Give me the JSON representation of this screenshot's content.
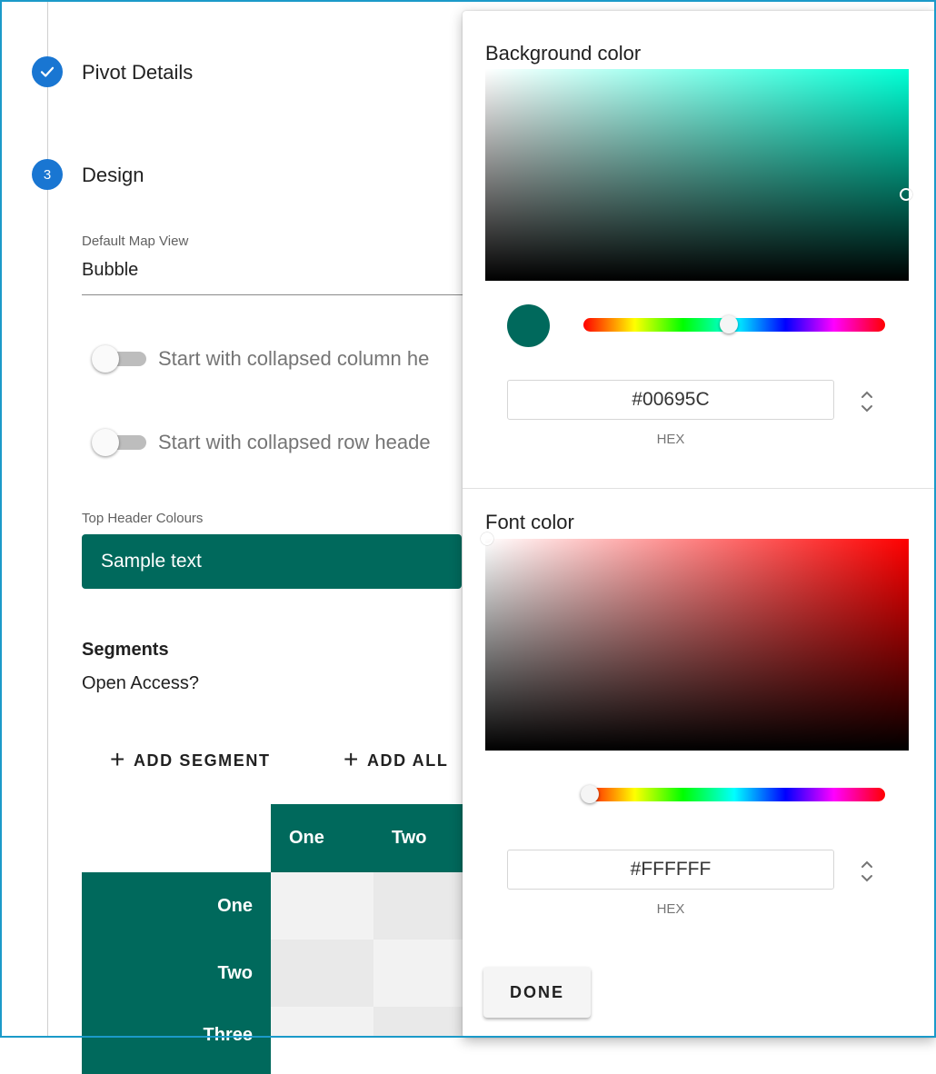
{
  "stepper": {
    "step_pivot_details": {
      "label": "Pivot Details",
      "icon": "check-icon"
    },
    "step_design": {
      "number": "3",
      "label": "Design"
    }
  },
  "design": {
    "default_map_view": {
      "label": "Default Map View",
      "value": "Bubble"
    },
    "toggle_collapsed_columns": {
      "label": "Start with collapsed column he",
      "checked": false
    },
    "toggle_collapsed_rows": {
      "label": "Start with collapsed row heade",
      "checked": false
    },
    "top_header_colours": {
      "label": "Top Header Colours",
      "sample_text": "Sample text"
    },
    "segments": {
      "title": "Segments",
      "subtitle": "Open Access?"
    },
    "buttons": {
      "add_segment": "ADD SEGMENT",
      "add_all": "ADD ALL"
    },
    "preview_table": {
      "column_headers": [
        "One",
        "Two"
      ],
      "row_headers": [
        "One",
        "Two",
        "Three"
      ]
    }
  },
  "color_picker": {
    "background": {
      "title": "Background color",
      "hex": "#00695C",
      "format": "HEX",
      "hue_color": "#00ffd5"
    },
    "font": {
      "title": "Font color",
      "hex": "#FFFFFF",
      "format": "HEX",
      "hue_color": "#ff0000"
    },
    "done_label": "DONE"
  },
  "colors": {
    "accent": "#1976d2",
    "header_bg": "#00695c",
    "frame": "#1b9ac9"
  }
}
